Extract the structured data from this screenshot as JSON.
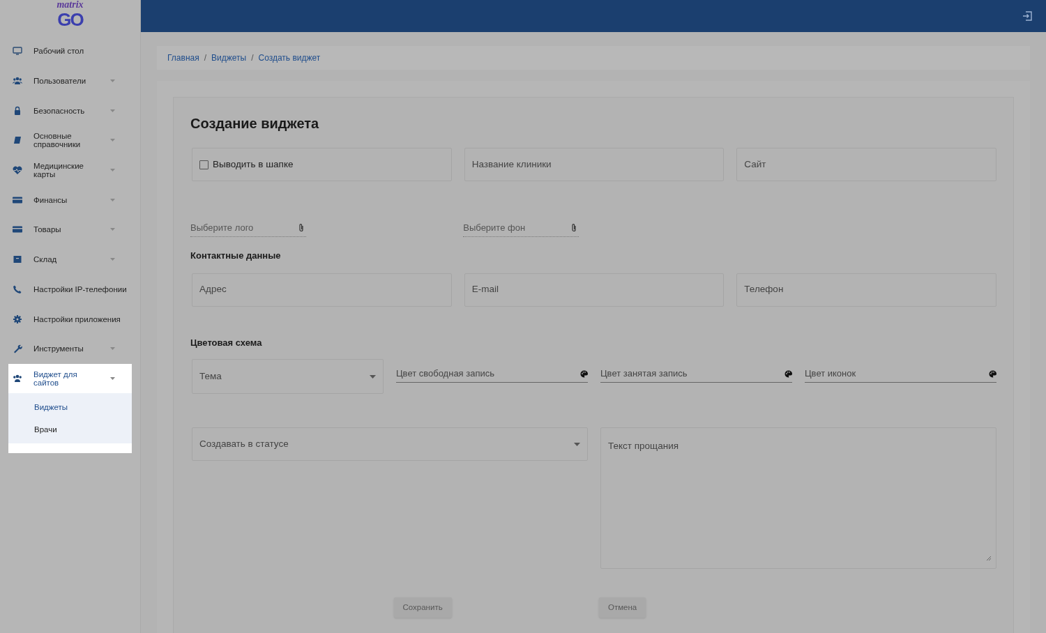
{
  "logo": {
    "script": "matrix",
    "mark": "GO"
  },
  "sidebar": {
    "items": [
      {
        "label": "Рабочий стол",
        "expandable": false,
        "expanded": false
      },
      {
        "label": "Пользователи",
        "expandable": true,
        "expanded": false
      },
      {
        "label": "Безопасность",
        "expandable": true,
        "expanded": false
      },
      {
        "label": "Основные справочники",
        "expandable": true,
        "expanded": false
      },
      {
        "label": "Медицинские карты",
        "expandable": true,
        "expanded": false
      },
      {
        "label": "Финансы",
        "expandable": true,
        "expanded": false
      },
      {
        "label": "Товары",
        "expandable": true,
        "expanded": false
      },
      {
        "label": "Склад",
        "expandable": true,
        "expanded": false
      },
      {
        "label": "Настройки IP-телефонии",
        "expandable": false,
        "expanded": false
      },
      {
        "label": "Настройки приложения",
        "expandable": false,
        "expanded": false
      },
      {
        "label": "Инструменты",
        "expandable": true,
        "expanded": false
      },
      {
        "label": "Виджет для сайтов",
        "expandable": true,
        "expanded": true,
        "children": [
          {
            "label": "Виджеты",
            "selected": true
          },
          {
            "label": "Врачи",
            "selected": false
          }
        ]
      }
    ]
  },
  "breadcrumbs": [
    {
      "kind": "link",
      "label": "Главная"
    },
    {
      "kind": "separator",
      "label": "/"
    },
    {
      "kind": "link",
      "label": "Виджеты"
    },
    {
      "kind": "separator",
      "label": "/"
    },
    {
      "kind": "link",
      "label": "Создать виджет"
    }
  ],
  "form": {
    "title": "Создание виджета",
    "show_in_header": {
      "label": "Выводить в шапке",
      "checked": false
    },
    "clinic_name": {
      "placeholder": "Название клиники"
    },
    "site": {
      "placeholder": "Сайт"
    },
    "files": [
      {
        "placeholder": "Выберите лого"
      },
      {
        "placeholder": "Выберите фон"
      }
    ],
    "contacts_heading": "Контактные данные",
    "contacts": [
      {
        "placeholder": "Адрес"
      },
      {
        "placeholder": "E-mail"
      },
      {
        "placeholder": "Телефон"
      }
    ],
    "color_heading": "Цветовая схема",
    "theme": {
      "placeholder": "Тема"
    },
    "colors": [
      {
        "placeholder": "Цвет свободная запись"
      },
      {
        "placeholder": "Цвет занятая запись"
      },
      {
        "placeholder": "Цвет иконок"
      }
    ],
    "status": {
      "placeholder": "Создавать в статусе"
    },
    "farewell": {
      "placeholder": "Текст прощания"
    },
    "buttons": [
      {
        "label": "Сохранить",
        "disabled": true
      },
      {
        "label": "Отмена",
        "disabled": true
      }
    ]
  }
}
